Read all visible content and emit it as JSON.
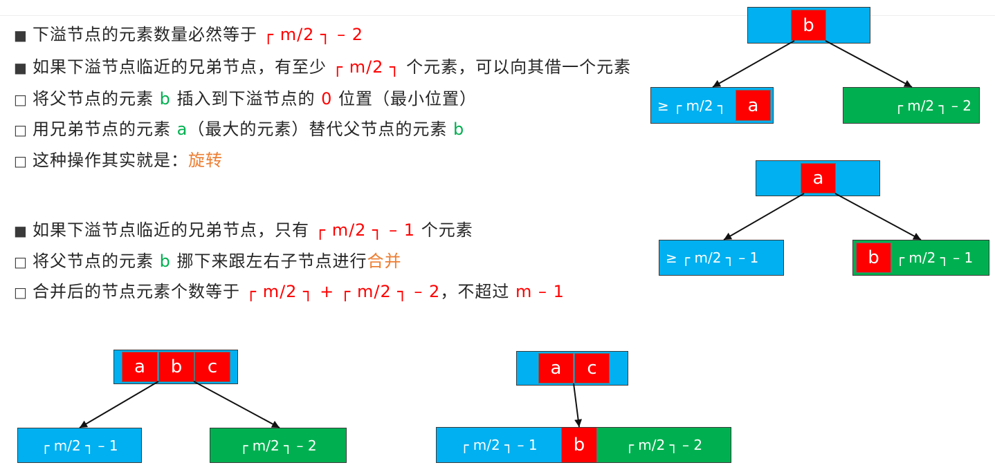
{
  "colors": {
    "node_blue": "#00b0f0",
    "node_green": "#00b050",
    "key_red": "#ff0000",
    "text_dark": "#262626",
    "text_red": "#ff0000",
    "text_green": "#00b050",
    "text_orange": "#ed7d31"
  },
  "bullets": [
    {
      "marker": "■",
      "segments": [
        "下溢节点的元素数量必然等于 ",
        "┌ m/2 ┐ – 2"
      ]
    },
    {
      "marker": "■",
      "segments": [
        "如果下溢节点临近的兄弟节点，有至少 ",
        "┌ m/2 ┐",
        " 个元素，可以向其借一个元素"
      ]
    },
    {
      "marker": "□",
      "segments": [
        "将父节点的元素 ",
        "b",
        " 插入到下溢节点的 ",
        "0",
        " 位置（最小位置）"
      ]
    },
    {
      "marker": "□",
      "segments": [
        "用兄弟节点的元素 ",
        "a",
        "（最大的元素）替代父节点的元素 ",
        "b"
      ]
    },
    {
      "marker": "□",
      "segments": [
        "这种操作其实就是：",
        "旋转"
      ]
    },
    {
      "marker": "■",
      "segments": [
        "如果下溢节点临近的兄弟节点，只有 ",
        "┌ m/2 ┐ – 1",
        " 个元素"
      ]
    },
    {
      "marker": "□",
      "segments": [
        "将父节点的元素 ",
        "b",
        " 挪下来跟左右子节点进行",
        "合并"
      ]
    },
    {
      "marker": "□",
      "segments": [
        "合并后的节点元素个数等于 ",
        "┌ m/2 ┐ + ┌ m/2 ┐ – 2",
        "，不超过 ",
        "m – 1"
      ]
    }
  ],
  "diagrams": {
    "rotation_before": {
      "parent": {
        "keys": [
          "b"
        ]
      },
      "left_child": {
        "label": "≥ ┌ m/2 ┐",
        "keys": [
          "a"
        ]
      },
      "right_child": {
        "label": "┌ m/2 ┐ – 2"
      }
    },
    "rotation_after": {
      "parent": {
        "keys": [
          "a"
        ]
      },
      "left_child": {
        "label": "≥ ┌ m/2 ┐ – 1"
      },
      "right_child": {
        "keys": [
          "b"
        ],
        "label": "┌ m/2 ┐ – 1"
      }
    },
    "merge_before": {
      "parent": {
        "keys": [
          "a",
          "b",
          "c"
        ]
      },
      "left_child": {
        "label": "┌ m/2 ┐ – 1"
      },
      "right_child": {
        "label": "┌ m/2 ┐ – 2"
      }
    },
    "merge_after": {
      "parent": {
        "keys": [
          "a",
          "c"
        ]
      },
      "merged_child": {
        "left_label": "┌ m/2 ┐ – 1",
        "key": "b",
        "right_label": "┌ m/2 ┐ – 2"
      }
    }
  }
}
